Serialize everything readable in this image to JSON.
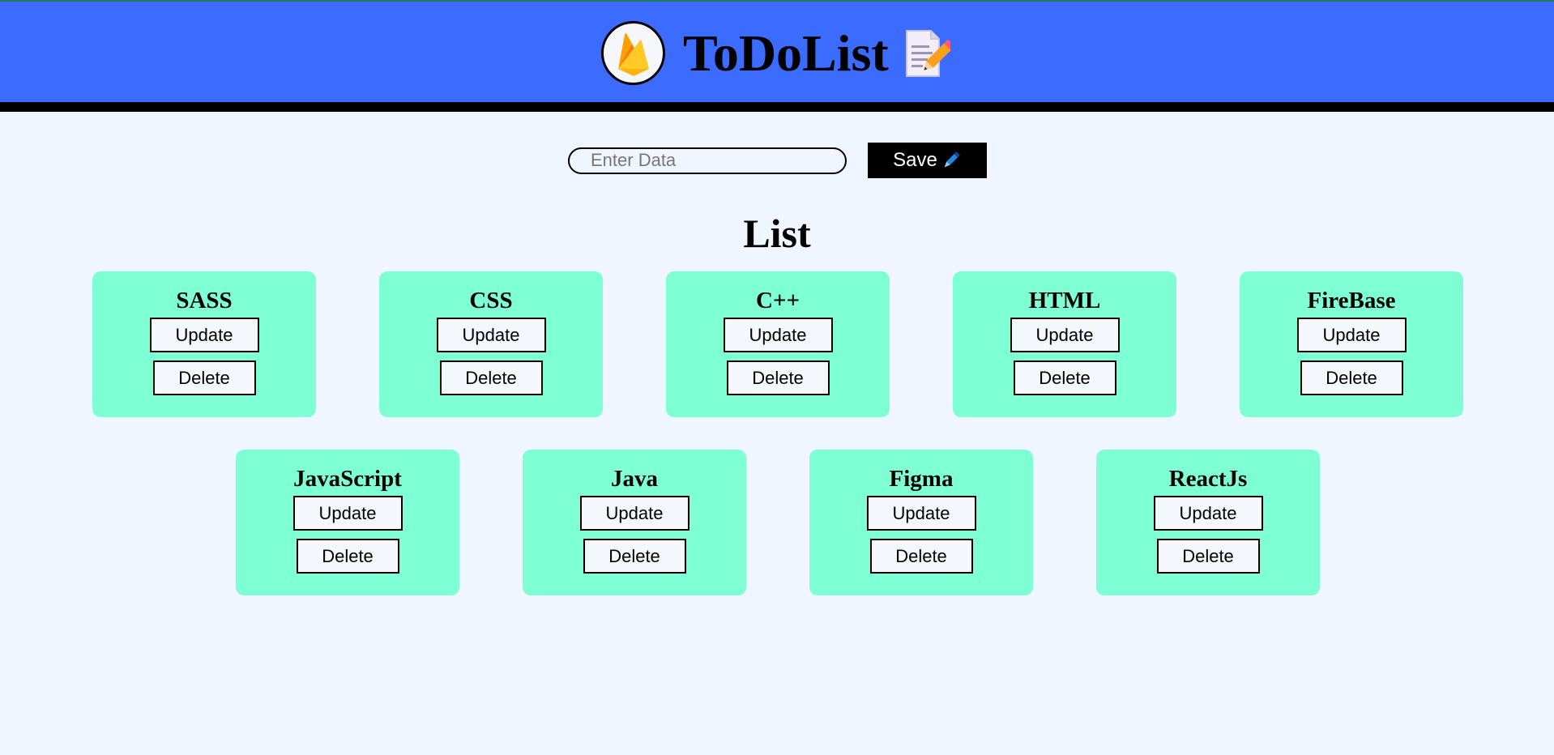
{
  "header": {
    "title": "ToDoList",
    "logo_icon": "firebase-flame-icon",
    "title_icon": "memo-pencil-icon",
    "background_color": "#3b6bff"
  },
  "entry": {
    "placeholder": "Enter Data",
    "value": "",
    "save_label": "Save",
    "save_icon": "pen-icon"
  },
  "list": {
    "title": "List",
    "card_color": "#7fffd4",
    "items": [
      {
        "title": "SASS",
        "update_label": "Update",
        "delete_label": "Delete"
      },
      {
        "title": "CSS",
        "update_label": "Update",
        "delete_label": "Delete"
      },
      {
        "title": "C++",
        "update_label": "Update",
        "delete_label": "Delete"
      },
      {
        "title": "HTML",
        "update_label": "Update",
        "delete_label": "Delete"
      },
      {
        "title": "FireBase",
        "update_label": "Update",
        "delete_label": "Delete"
      },
      {
        "title": "JavaScript",
        "update_label": "Update",
        "delete_label": "Delete"
      },
      {
        "title": "Java",
        "update_label": "Update",
        "delete_label": "Delete"
      },
      {
        "title": "Figma",
        "update_label": "Update",
        "delete_label": "Delete"
      },
      {
        "title": "ReactJs",
        "update_label": "Update",
        "delete_label": "Delete"
      }
    ]
  }
}
